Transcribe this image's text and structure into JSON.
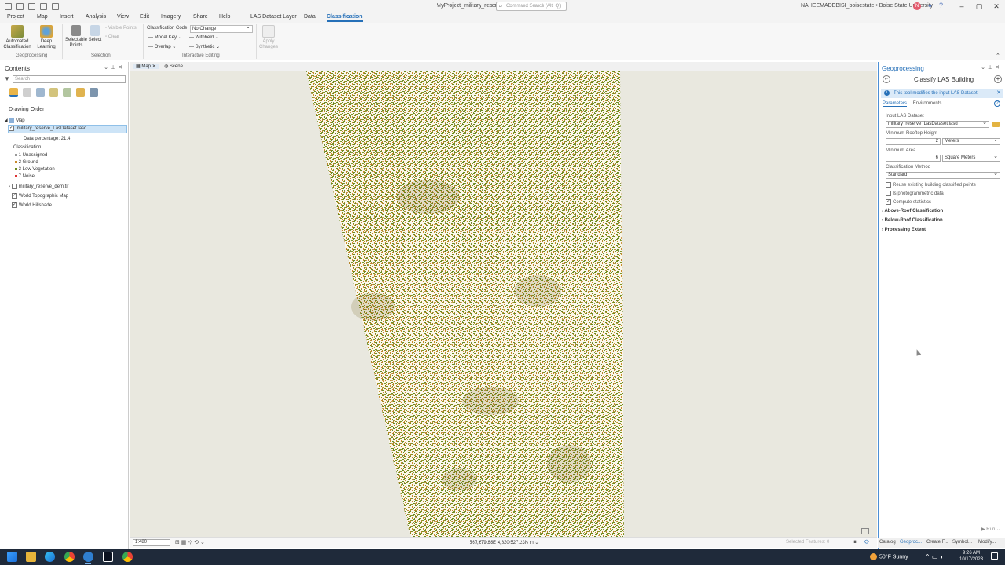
{
  "titlebar": {
    "project_title": "MyProject_military_reserve",
    "command_search_placeholder": "Command Search (Alt+Q)",
    "user": "NAHEEMADEBISI_boisestate • Boise State University",
    "avatar_initial": "N"
  },
  "menu": {
    "tabs": [
      "Project",
      "Map",
      "Insert",
      "Analysis",
      "View",
      "Edit",
      "Imagery",
      "Share",
      "Help",
      "LAS Dataset Layer",
      "Data",
      "Classification"
    ],
    "active_tab": "Classification"
  },
  "ribbon": {
    "automated_classification": "Automated\nClassification",
    "deep_learning": "Deep\nLearning",
    "geoprocessing_group": "Geoprocessing",
    "selectable_points": "Selectable\nPoints",
    "select": "Select",
    "visible_points": "Visible Points",
    "clear": "Clear",
    "selection_group": "Selection",
    "classification_code_label": "Classification Code",
    "classification_code_value": "No Change",
    "model_key": "Model Key",
    "overlap": "Overlap",
    "withheld": "Withheld",
    "synthetic": "Synthetic",
    "interactive_editing_group": "Interactive Editing",
    "apply_changes": "Apply\nChanges"
  },
  "contents": {
    "title": "Contents",
    "search_placeholder": "Search",
    "drawing_order": "Drawing Order",
    "map_node": "Map",
    "las_layer": "military_reserve_LasDataset.lasd",
    "data_percentage": "Data percentage: 21.4",
    "classification_heading": "Classification",
    "classes": [
      "1  Unassigned",
      "2  Ground",
      "3  Low Vegetation",
      "7  Noise"
    ],
    "dem_layer": "military_reserve_dem.tif",
    "topo_layer": "World Topographic Map",
    "hillshade_layer": "World Hillshade"
  },
  "map": {
    "tabs": [
      "Map",
      "Scene"
    ],
    "active_tab": "Map",
    "scale": "1:480",
    "coordinates": "567,679.65E 4,830,527.23N m",
    "selected_features": "Selected Features: 0"
  },
  "geoprocessing": {
    "title": "Geoprocessing",
    "tool_name": "Classify LAS Building",
    "info_message": "This tool modifies the input LAS Dataset",
    "tabs": [
      "Parameters",
      "Environments"
    ],
    "active_tab": "Parameters",
    "input_las_label": "Input LAS Dataset",
    "input_las_value": "military_reserve_LasDataset.lasd",
    "min_rooftop_label": "Minimum Rooftop Height",
    "min_rooftop_value": "2",
    "min_rooftop_unit": "Meters",
    "min_area_label": "Minimum Area",
    "min_area_value": "6",
    "min_area_unit": "Square Meters",
    "method_label": "Classification Method",
    "method_value": "Standard",
    "reuse_label": "Reuse existing building classified points",
    "photogrammetric_label": "Is photogrammetric data",
    "compute_stats_label": "Compute statistics",
    "sections": [
      "Above-Roof Classification",
      "Below-Roof Classification",
      "Processing Extent"
    ],
    "run_label": "Run"
  },
  "bottom_tabs": [
    "Catalog",
    "Geoproc...",
    "Create F...",
    "Symbol...",
    "Modify..."
  ],
  "taskbar": {
    "weather": "50°F  Sunny",
    "time": "9:26 AM",
    "date": "10/17/2023"
  },
  "colors": {
    "accent": "#2670b8",
    "map_background": "#e9e8df",
    "point_green": "#6b8a1e",
    "point_orange": "#c98a2a",
    "point_white": "#ffffff",
    "taskbar": "#1f2a3a"
  }
}
